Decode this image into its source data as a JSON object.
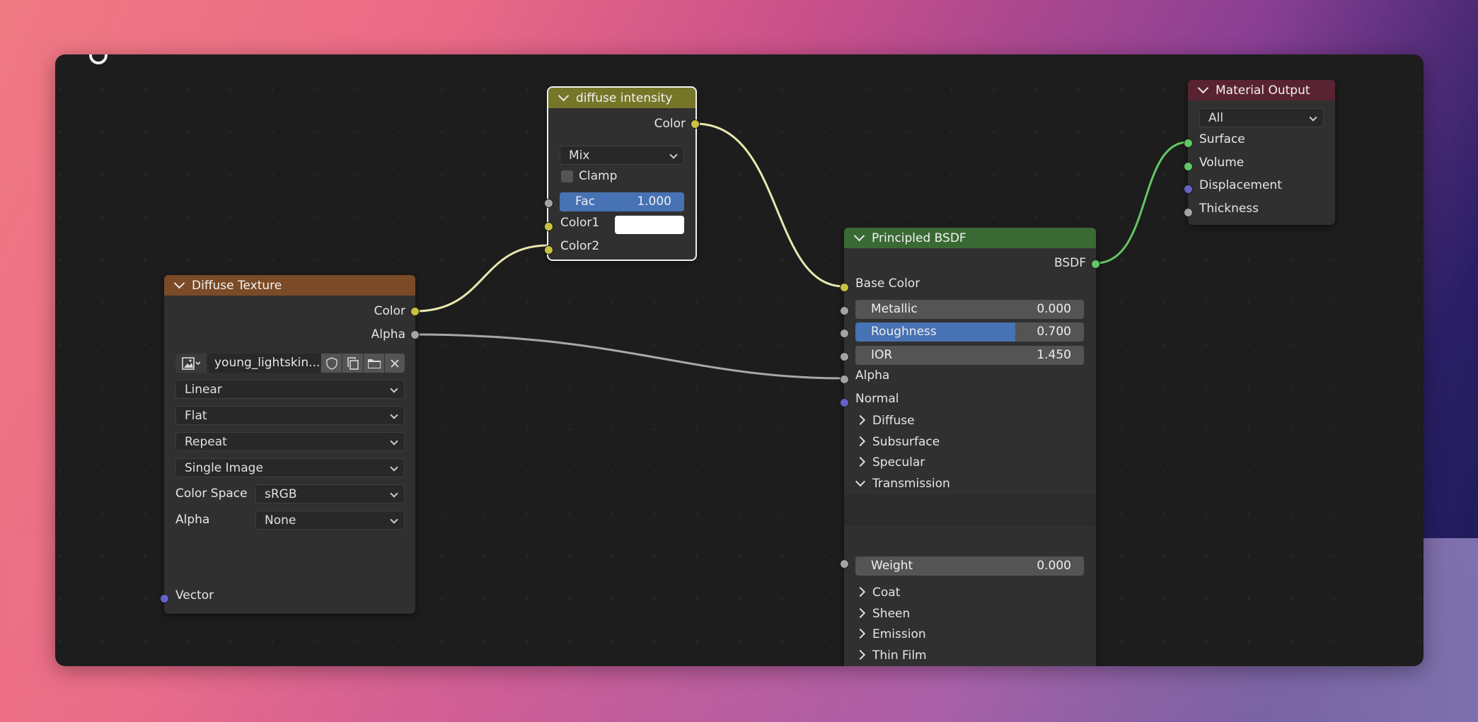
{
  "colors": {
    "mix_header": "#767628",
    "texture_header": "#7b4a26",
    "bsdf_header": "#3a6a34",
    "output_header": "#5a2332",
    "slider_fill": "#4772b3",
    "wire_color": "#e8e8b0",
    "wire_gray": "#a8a8a8",
    "wire_shader": "#63c763"
  },
  "mix_node": {
    "title": "diffuse intensity",
    "output_color": "Color",
    "blend_mode": "Mix",
    "clamp_label": "Clamp",
    "clamp_checked": false,
    "fac_label": "Fac",
    "fac_value": "1.000",
    "fac_fraction": 1.0,
    "color1_label": "Color1",
    "color1_value": "#ffffff",
    "color2_label": "Color2"
  },
  "texture_node": {
    "title": "Diffuse Texture",
    "output_color": "Color",
    "output_alpha": "Alpha",
    "image_name": "young_lightskin...",
    "interpolation": "Linear",
    "projection": "Flat",
    "extension": "Repeat",
    "source": "Single Image",
    "color_space_label": "Color Space",
    "color_space": "sRGB",
    "alpha_label": "Alpha",
    "alpha_mode": "None",
    "vector_label": "Vector"
  },
  "bsdf_node": {
    "title": "Principled BSDF",
    "output_bsdf": "BSDF",
    "base_color_label": "Base Color",
    "metallic_label": "Metallic",
    "metallic_value": "0.000",
    "metallic_fraction": 0.0,
    "roughness_label": "Roughness",
    "roughness_value": "0.700",
    "roughness_fraction": 0.7,
    "ior_label": "IOR",
    "ior_value": "1.450",
    "alpha_label": "Alpha",
    "normal_label": "Normal",
    "panels": {
      "diffuse": "Diffuse",
      "subsurface": "Subsurface",
      "specular": "Specular",
      "transmission": "Transmission",
      "coat": "Coat",
      "sheen": "Sheen",
      "emission": "Emission",
      "thin_film": "Thin Film"
    },
    "weight_label": "Weight",
    "weight_value": "0.000",
    "weight_fraction": 0.0
  },
  "output_node": {
    "title": "Material Output",
    "target": "All",
    "surface_label": "Surface",
    "volume_label": "Volume",
    "displacement_label": "Displacement",
    "thickness_label": "Thickness"
  },
  "icons": {
    "image_browse": "image-icon",
    "fake_user": "shield-icon",
    "duplicate": "duplicate-icon",
    "open": "folder-icon",
    "unlink": "close-icon"
  }
}
